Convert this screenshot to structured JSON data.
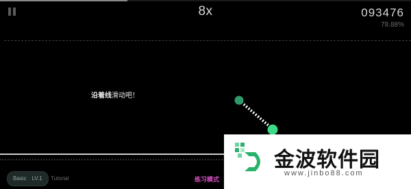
{
  "hud": {
    "progress": 0.31,
    "combo": "8x",
    "score": "093476",
    "accuracy": "78.88%"
  },
  "hint": {
    "bold_text": "沿着线",
    "rest_text": "滑动吧！"
  },
  "footer": {
    "level_name": "Basic",
    "level_value": "LV.1",
    "tutorial": "Tutorial",
    "practice_mode": "练习模式"
  },
  "notes": {
    "color": "#3fd98a",
    "dark_color": "#2e9a6a"
  },
  "watermark": {
    "title": "金波软件园",
    "url": "www.jinbo88.com"
  }
}
